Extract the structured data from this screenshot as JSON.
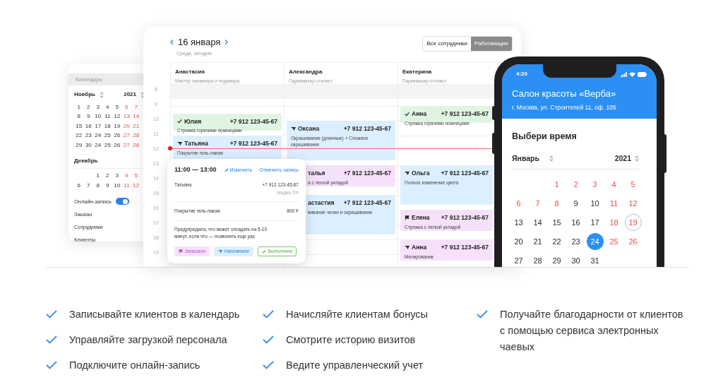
{
  "sidebar": {
    "header": "Календарь",
    "months": [
      {
        "name": "Ноябрь",
        "year": "2021",
        "days": [
          {
            "kind": "day",
            "day": "1",
            "weekend": false
          },
          {
            "kind": "day",
            "day": "2",
            "weekend": false
          },
          {
            "kind": "day",
            "day": "3",
            "weekend": false
          },
          {
            "kind": "day",
            "day": "4",
            "weekend": false
          },
          {
            "kind": "day",
            "day": "5",
            "weekend": false
          },
          {
            "kind": "day",
            "day": "6",
            "weekend": true
          },
          {
            "kind": "day",
            "day": "7",
            "weekend": true
          },
          {
            "kind": "day",
            "day": "8",
            "weekend": false
          },
          {
            "kind": "day",
            "day": "9",
            "weekend": false
          },
          {
            "kind": "day",
            "day": "10",
            "weekend": false
          },
          {
            "kind": "day",
            "day": "11",
            "weekend": false
          },
          {
            "kind": "day",
            "day": "12",
            "weekend": false
          },
          {
            "kind": "day",
            "day": "13",
            "weekend": true
          },
          {
            "kind": "day",
            "day": "14",
            "weekend": true
          },
          {
            "kind": "day",
            "day": "15",
            "weekend": false
          },
          {
            "kind": "day",
            "day": "16",
            "weekend": false
          },
          {
            "kind": "day",
            "day": "17",
            "weekend": false
          },
          {
            "kind": "day",
            "day": "18",
            "weekend": false
          },
          {
            "kind": "day",
            "day": "19",
            "weekend": false
          },
          {
            "kind": "day",
            "day": "20",
            "weekend": true
          },
          {
            "kind": "day",
            "day": "21",
            "weekend": true
          },
          {
            "kind": "day",
            "day": "22",
            "weekend": false
          },
          {
            "kind": "day",
            "day": "23",
            "weekend": false
          },
          {
            "kind": "day",
            "day": "24",
            "weekend": false
          },
          {
            "kind": "day",
            "day": "25",
            "weekend": false
          },
          {
            "kind": "day",
            "day": "26",
            "weekend": false
          },
          {
            "kind": "day",
            "day": "27",
            "weekend": true
          },
          {
            "kind": "day",
            "day": "28",
            "weekend": true
          },
          {
            "kind": "day",
            "day": "29",
            "weekend": false
          },
          {
            "kind": "day",
            "day": "30",
            "weekend": false
          },
          {
            "kind": "day",
            "day": "24",
            "weekend": false
          },
          {
            "kind": "day",
            "day": "25",
            "weekend": false
          },
          {
            "kind": "day",
            "day": "26",
            "weekend": false
          },
          {
            "kind": "day",
            "day": "27",
            "weekend": true
          },
          {
            "kind": "day",
            "day": "28",
            "weekend": true
          }
        ]
      },
      {
        "name": "Декабрь",
        "days": [
          {
            "kind": "empty"
          },
          {
            "kind": "empty"
          },
          {
            "kind": "day",
            "day": "1",
            "weekend": false
          },
          {
            "kind": "day",
            "day": "2",
            "weekend": false
          },
          {
            "kind": "day",
            "day": "3",
            "weekend": false
          },
          {
            "kind": "day",
            "day": "4",
            "weekend": true
          },
          {
            "kind": "day",
            "day": "5",
            "weekend": true
          },
          {
            "kind": "day",
            "day": "6",
            "weekend": false
          },
          {
            "kind": "day",
            "day": "7",
            "weekend": false
          },
          {
            "kind": "day",
            "day": "8",
            "weekend": false
          },
          {
            "kind": "day",
            "day": "9",
            "weekend": false
          },
          {
            "kind": "day",
            "day": "10",
            "weekend": false
          },
          {
            "kind": "day",
            "day": "11",
            "weekend": true
          },
          {
            "kind": "day",
            "day": "12",
            "weekend": true
          }
        ]
      }
    ],
    "online_booking": {
      "label": "Онлайн-запись",
      "on": true
    },
    "items": [
      "Заказы",
      "Сотрудники",
      "Клиенты"
    ]
  },
  "schedule": {
    "date": "16 января",
    "subtitle": "Среда, сегодня",
    "filters": [
      {
        "label": "Все сотрудники",
        "selected": false
      },
      {
        "label": "Работающие",
        "selected": true
      }
    ],
    "hours": [
      "8",
      "9",
      "10",
      "11",
      "12",
      "13",
      "14",
      "15",
      "16",
      "17",
      "18",
      "19"
    ],
    "staff": [
      {
        "name": "Анастасия",
        "role": "Мастер маникюра и педикюра",
        "appointments": [
          {
            "client": "Юлия",
            "phone": "+7 912 123-45-67",
            "service": "Стрижка горячими ножницами",
            "kind": "done",
            "color": "#dff5e1"
          },
          {
            "client": "Татьяна",
            "phone": "+7 912 123-45-67",
            "service": "Покрытие гель-лаком",
            "kind": "reminded",
            "color": "#dcefff"
          }
        ]
      },
      {
        "name": "Александра",
        "role": "Парикмахер-стилист",
        "appointments": [
          {
            "client": "Оксана",
            "phone": "+7 912 123-45-67",
            "service": "Окрашивание (длинные) + Сложное окрашивание",
            "kind": "reminded",
            "color": "#dcefff"
          },
          {
            "client": "талья",
            "phone": "+7 912 123-45-67",
            "service": "а с легкой укладой",
            "kind": "hidden",
            "color": "#f6e1fb"
          },
          {
            "client": "астастия",
            "phone": "+7 912 123-45-67",
            "service": "вивание челки и окрашивание",
            "kind": "hidden",
            "color": "#dcefff"
          }
        ]
      },
      {
        "name": "Екатерина",
        "role": "Парикмахер-стилист",
        "appointments": [
          {
            "client": "Анна",
            "phone": "+7 912 123-45-67",
            "service": "Стрижка горячими ножницами",
            "kind": "done",
            "color": "#dff5e1"
          },
          {
            "client": "Ольга",
            "phone": "+7 912 123-45-67",
            "service": "Полное изменение цвета",
            "kind": "reminded",
            "color": "#dcefff"
          },
          {
            "client": "Елена",
            "phone": "+7 912 123-45-67",
            "service": "Стрижка с легкой укладой",
            "kind": "booked",
            "color": "#f6e1fb"
          },
          {
            "client": "Анна",
            "phone": "+7 912 123-45-67",
            "service": "Мелирование",
            "kind": "reminded",
            "color": "#f6e1fb"
          }
        ]
      }
    ]
  },
  "popup": {
    "time": "11:00 — 13:00",
    "edit": "Изменить",
    "cancel": "Отменить запись",
    "client": "Татьяна",
    "phone": "+7 912 123-45-67",
    "discount": "скидка 3%",
    "service": "Покрытие гель-лаком",
    "price": "800 ₽",
    "note": "Предупредила, что может опоздать на 5-10 минут, если что — позвонить еще раз",
    "actions": [
      {
        "label": "Записали",
        "kind": "booked",
        "selected": false
      },
      {
        "label": "Напомнили",
        "kind": "reminded",
        "selected": false
      },
      {
        "label": "Выполнили",
        "kind": "done",
        "selected": true
      }
    ]
  },
  "phone": {
    "time": "4:20",
    "title": "Салон красоты «Верба»",
    "address": "г. Москва, ул. Строителей 11, оф. 105",
    "heading": "Выбери время",
    "month": "Январь",
    "year": "2021",
    "days": [
      {
        "kind": "empty"
      },
      {
        "kind": "empty"
      },
      {
        "kind": "day",
        "day": "1",
        "holiday": true,
        "today": false,
        "selected": false
      },
      {
        "kind": "day",
        "day": "2",
        "holiday": true,
        "today": false,
        "selected": false
      },
      {
        "kind": "day",
        "day": "3",
        "holiday": true,
        "today": false,
        "selected": false
      },
      {
        "kind": "day",
        "day": "4",
        "holiday": true,
        "today": false,
        "selected": false
      },
      {
        "kind": "day",
        "day": "5",
        "holiday": true,
        "today": false,
        "selected": false
      },
      {
        "kind": "day",
        "day": "6",
        "holiday": true,
        "today": false,
        "selected": false
      },
      {
        "kind": "day",
        "day": "7",
        "holiday": true,
        "today": false,
        "selected": false
      },
      {
        "kind": "day",
        "day": "8",
        "holiday": true,
        "today": false,
        "selected": false
      },
      {
        "kind": "day",
        "day": "9",
        "holiday": false,
        "today": false,
        "selected": false
      },
      {
        "kind": "day",
        "day": "10",
        "holiday": false,
        "today": false,
        "selected": false
      },
      {
        "kind": "day",
        "day": "11",
        "holiday": true,
        "today": false,
        "selected": false
      },
      {
        "kind": "day",
        "day": "12",
        "holiday": true,
        "today": false,
        "selected": false
      },
      {
        "kind": "day",
        "day": "13",
        "holiday": false,
        "today": false,
        "selected": false
      },
      {
        "kind": "day",
        "day": "14",
        "holiday": false,
        "today": false,
        "selected": false
      },
      {
        "kind": "day",
        "day": "15",
        "holiday": false,
        "today": false,
        "selected": false
      },
      {
        "kind": "day",
        "day": "16",
        "holiday": false,
        "today": false,
        "selected": false
      },
      {
        "kind": "day",
        "day": "17",
        "holiday": false,
        "today": false,
        "selected": false
      },
      {
        "kind": "day",
        "day": "18",
        "holiday": true,
        "today": false,
        "selected": false
      },
      {
        "kind": "day",
        "day": "19",
        "holiday": true,
        "today": true,
        "selected": false
      },
      {
        "kind": "day",
        "day": "20",
        "holiday": false,
        "today": false,
        "selected": false
      },
      {
        "kind": "day",
        "day": "21",
        "holiday": false,
        "today": false,
        "selected": false
      },
      {
        "kind": "day",
        "day": "22",
        "holiday": false,
        "today": false,
        "selected": false
      },
      {
        "kind": "day",
        "day": "23",
        "holiday": false,
        "today": false,
        "selected": false
      },
      {
        "kind": "day",
        "day": "24",
        "holiday": false,
        "today": false,
        "selected": true
      },
      {
        "kind": "day",
        "day": "25",
        "holiday": true,
        "today": false,
        "selected": false
      },
      {
        "kind": "day",
        "day": "26",
        "holiday": true,
        "today": false,
        "selected": false
      },
      {
        "kind": "day",
        "day": "27",
        "holiday": false,
        "today": false,
        "selected": false
      },
      {
        "kind": "day",
        "day": "28",
        "holiday": false,
        "today": false,
        "selected": false
      },
      {
        "kind": "day",
        "day": "29",
        "holiday": false,
        "today": false,
        "selected": false
      },
      {
        "kind": "day",
        "day": "30",
        "holiday": false,
        "today": false,
        "selected": false
      },
      {
        "kind": "day",
        "day": "31",
        "holiday": false,
        "today": false,
        "selected": false
      }
    ]
  },
  "features": [
    [
      "Записывайте клиентов в календарь",
      "Управляйте загрузкой персонала",
      "Подключите онлайн-запись"
    ],
    [
      "Начисляйте клиентам бонусы",
      "Смотрите историю визитов",
      "Ведите управленческий учет"
    ],
    [
      "Получайте благодарности от клиентов с помощью сервиса электронных чаевых"
    ]
  ]
}
